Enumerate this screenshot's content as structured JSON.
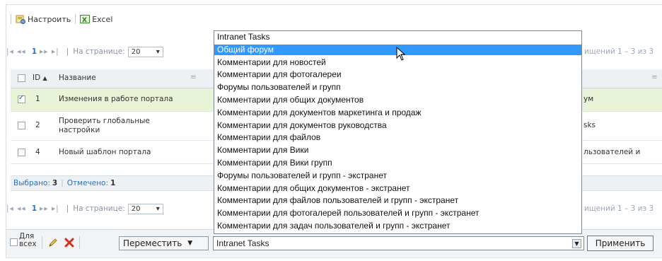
{
  "toolbar": {
    "configure_label": "Настроить",
    "excel_label": "Excel"
  },
  "pager": {
    "page_number": "1",
    "per_page_label": "На странице:",
    "per_page_value": "20",
    "range_text": "ищений 1 – 3 из 3"
  },
  "table": {
    "headers": {
      "id": "ID",
      "title": "Название"
    },
    "rows": [
      {
        "id": "1",
        "title": "Изменения в работе портала",
        "forum": "ум",
        "checked": true
      },
      {
        "id": "2",
        "title_line1": "Проверить глобальные",
        "title_line2": "настройки",
        "forum": "sks",
        "checked": false
      },
      {
        "id": "4",
        "title": "Новый шаблон портала",
        "forum": "льзователей и",
        "checked": false
      }
    ]
  },
  "status": {
    "selected_label": "Выбрано:",
    "selected_value": "3",
    "marked_label": "Отмечено:",
    "marked_value": "1"
  },
  "actions": {
    "for_all_line1": "Для",
    "for_all_line2": "всех",
    "move_label": "Переместить",
    "target_select_value": "Intranet Tasks",
    "apply_label": "Применить"
  },
  "dropdown": {
    "options": [
      "Intranet Tasks",
      "Общий форум",
      "Комментарии для новостей",
      "Комментарии для фотогалереи",
      "Форумы пользователей и групп",
      "Комментарии для общих документов",
      "Комментарии для документов маркетинга и продаж",
      "Комментарии для документов руководства",
      "Комментарии для файлов",
      "Комментарии для Вики",
      "Комментарии для Вики групп",
      "Форумы пользователей и групп - экстранет",
      "Комментарии для общих документов - экстранет",
      "Комментарии для файлов пользователей и групп - экстранет",
      "Комментарии для фотогалерей пользователей и групп - экстранет",
      "Комментарии для задач пользователей и групп - экстранет"
    ],
    "highlighted": "Общий форум"
  },
  "colors": {
    "highlight": "#3399ff",
    "selected_row": "#e8f3d7",
    "link_blue": "#2a6fbd"
  }
}
